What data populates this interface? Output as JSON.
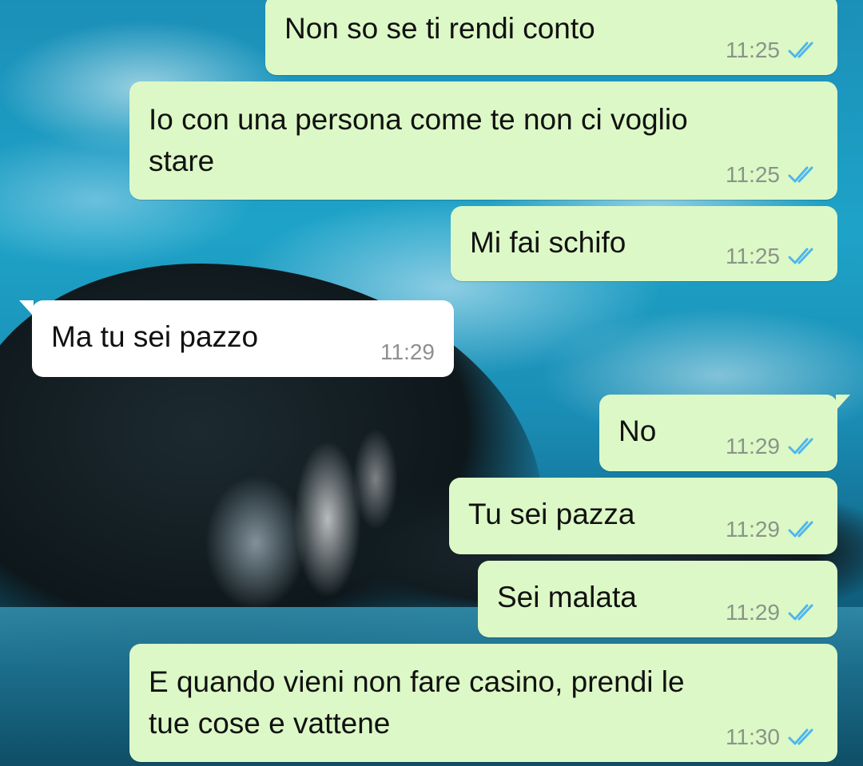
{
  "chat": {
    "messages": [
      {
        "direction": "out",
        "text": "Non so se ti rendi conto",
        "time": "11:25",
        "status": "read-double-check-icon"
      },
      {
        "direction": "out",
        "text": "Io con una persona come te non ci voglio\nstare",
        "time": "11:25",
        "status": "read-double-check-icon"
      },
      {
        "direction": "out",
        "text": "Mi fai schifo",
        "time": "11:25",
        "status": "read-double-check-icon"
      },
      {
        "direction": "in",
        "text": "Ma tu sei pazzo",
        "time": "11:29"
      },
      {
        "direction": "out",
        "text": "No",
        "time": "11:29",
        "status": "read-double-check-icon"
      },
      {
        "direction": "out",
        "text": "Tu sei pazza",
        "time": "11:29",
        "status": "read-double-check-icon"
      },
      {
        "direction": "out",
        "text": "Sei malata",
        "time": "11:29",
        "status": "read-double-check-icon"
      },
      {
        "direction": "out",
        "text": "E quando vieni non fare casino, prendi le\ntue cose e vattene",
        "time": "11:30",
        "status": "read-double-check-icon"
      }
    ]
  },
  "colors": {
    "outgoing_bubble": "#dcf8c6",
    "incoming_bubble": "#ffffff",
    "read_tick": "#4fb6ec",
    "timestamp": "#8a948a"
  }
}
